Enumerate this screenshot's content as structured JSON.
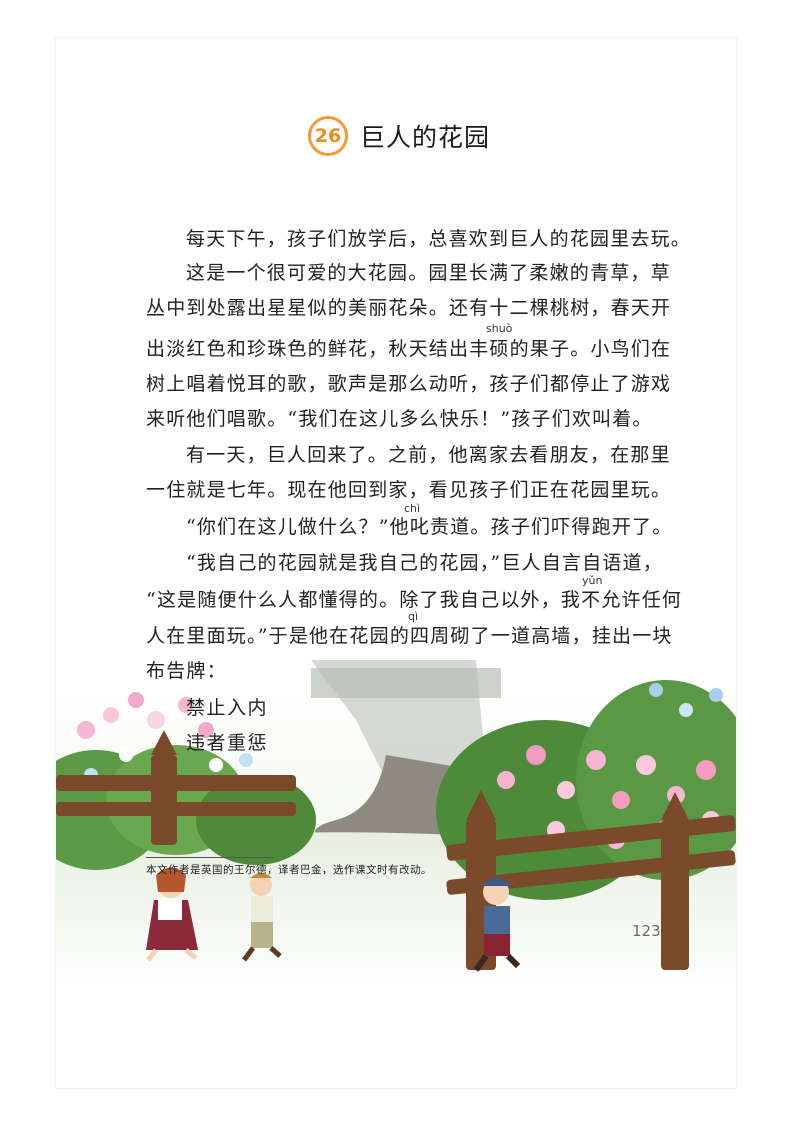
{
  "lesson": {
    "number": "26",
    "title": "巨人的花园"
  },
  "body": {
    "p1": "每天下午，孩子们放学后，总喜欢到巨人的花园里去玩。",
    "p2_l1": "这是一个很可爱的大花园。园里长满了柔嫩的青草，草",
    "p2_l2": "丛中到处露出星星似的美丽花朵。还有十二棵桃树，春天开",
    "p2_l3": "出淡红色和珍珠色的鲜花，秋天结出丰硕的果子。小鸟们在",
    "p2_l4": "树上唱着悦耳的歌，歌声是那么动听，孩子们都停止了游戏",
    "p2_l5": "来听他们唱歌。“我们在这儿多么快乐！”孩子们欢叫着。",
    "p3_l1": "有一天，巨人回来了。之前，他离家去看朋友，在那里",
    "p3_l2": "一住就是七年。现在他回到家，看见孩子们正在花园里玩。",
    "p4": "“你们在这儿做什么？”他叱责道。孩子们吓得跑开了。",
    "p5_l1": "“我自己的花园就是我自己的花园，”巨人自言自语道，",
    "p5_l2": "“这是随便什么人都懂得的。除了我自己以外，我不允许任何",
    "p5_l3": "人在里面玩。”于是他在花园的四周砌了一道高墙，挂出一块",
    "p5_l4": "布告牌："
  },
  "pinyin": {
    "shuo": "shuò",
    "chi": "chì",
    "yun": "yǔn",
    "qi": "qì"
  },
  "notice_board": {
    "line1": "禁止入内",
    "line2": "违者重惩"
  },
  "footnote": "本文作者是英国的王尔德，译者巴金，选作课文时有改动。",
  "page_number": "123",
  "colors": {
    "badge": "#f39a34",
    "text": "#222222",
    "flowers_pink": "#f3a9c8",
    "fence": "#7a4a2a"
  }
}
